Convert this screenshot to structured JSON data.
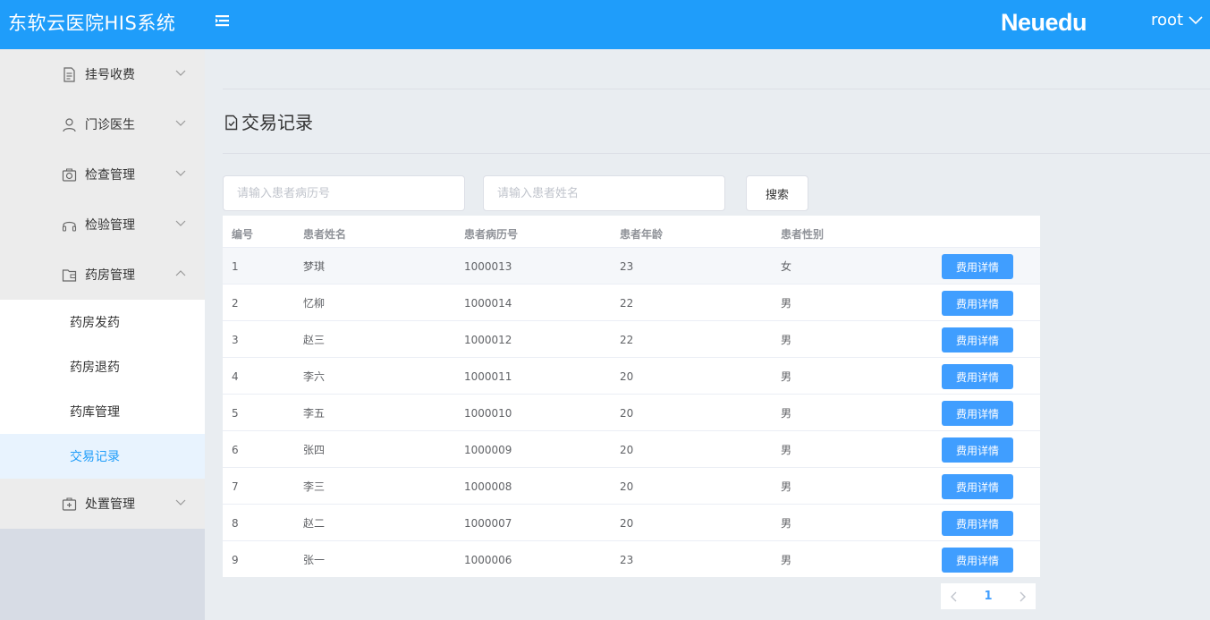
{
  "header": {
    "app_title": "东软云医院HIS系统",
    "brand": "Neuedu",
    "user": "root",
    "color": "#1f9dfa"
  },
  "sidebar": {
    "groups": [
      {
        "label": "挂号收费",
        "icon": "document-icon"
      },
      {
        "label": "门诊医生",
        "icon": "user-icon"
      },
      {
        "label": "检查管理",
        "icon": "camera-icon"
      },
      {
        "label": "检验管理",
        "icon": "headset-icon"
      },
      {
        "label": "药房管理",
        "icon": "wallet-icon"
      },
      {
        "label": "处置管理",
        "icon": "first-aid-icon"
      }
    ],
    "sub_items": [
      {
        "label": "药房发药"
      },
      {
        "label": "药房退药"
      },
      {
        "label": "药库管理"
      },
      {
        "label": "交易记录",
        "active": true
      }
    ]
  },
  "main": {
    "title": "交易记录",
    "search": {
      "record_placeholder": "请输入患者病历号",
      "name_placeholder": "请输入患者姓名",
      "button": "搜索"
    },
    "table": {
      "headers": [
        "编号",
        "患者姓名",
        "患者病历号",
        "患者年龄",
        "患者性别"
      ],
      "action_label": "费用详情",
      "rows": [
        [
          "1",
          "梦琪",
          "1000013",
          "23",
          "女"
        ],
        [
          "2",
          "忆柳",
          "1000014",
          "22",
          "男"
        ],
        [
          "3",
          "赵三",
          "1000012",
          "22",
          "男"
        ],
        [
          "4",
          "李六",
          "1000011",
          "20",
          "男"
        ],
        [
          "5",
          "李五",
          "1000010",
          "20",
          "男"
        ],
        [
          "6",
          "张四",
          "1000009",
          "20",
          "男"
        ],
        [
          "7",
          "李三",
          "1000008",
          "20",
          "男"
        ],
        [
          "8",
          "赵二",
          "1000007",
          "20",
          "男"
        ],
        [
          "9",
          "张一",
          "1000006",
          "23",
          "男"
        ]
      ]
    },
    "pagination": {
      "current_page": "1",
      "prev_icon": "chevron-left-icon",
      "next_icon": "chevron-right-icon"
    }
  }
}
